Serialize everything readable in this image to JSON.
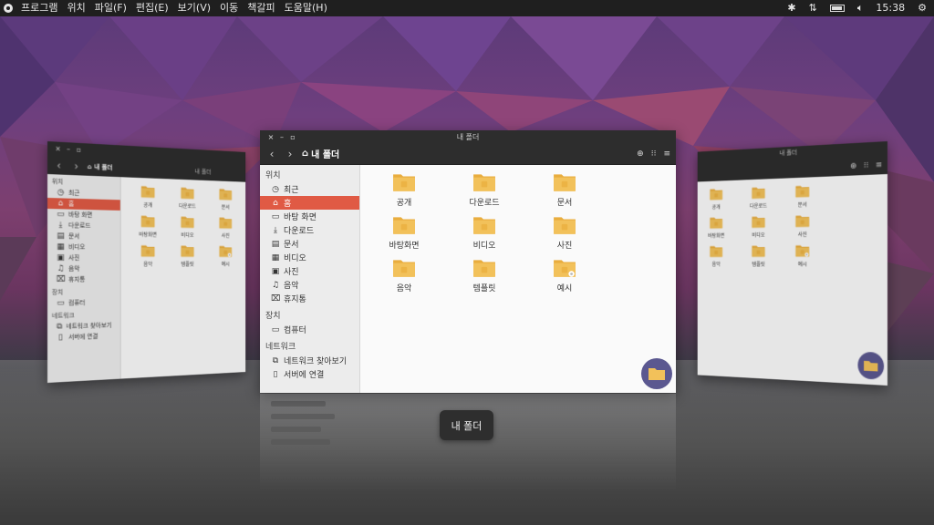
{
  "top_panel": {
    "menus": [
      "프로그램",
      "위치",
      "파일(F)",
      "편집(E)",
      "보기(V)",
      "이동",
      "책갈피",
      "도움말(H)"
    ],
    "clock": "15:38"
  },
  "main_window": {
    "title": "내 폴더",
    "path": "내 폴더",
    "sidebar": {
      "places_label": "위치",
      "places": [
        "최근",
        "홈",
        "바탕 화면",
        "다운로드",
        "문서",
        "비디오",
        "사진",
        "음악",
        "휴지통"
      ],
      "devices_label": "장치",
      "devices": [
        "컴퓨터"
      ],
      "network_label": "네트워크",
      "network": [
        "네트워크 찾아보기",
        "서버에 연결"
      ]
    },
    "folders": [
      "공개",
      "다운로드",
      "문서",
      "바탕화면",
      "비디오",
      "사진",
      "음악",
      "템플릿",
      "예시"
    ]
  },
  "left_window": {
    "title": "내 폴더",
    "path": "내 폴더",
    "sidebar": {
      "places_label": "위치",
      "places": [
        "최근",
        "홈",
        "바탕 화면",
        "다운로드",
        "문서",
        "비디오",
        "사진",
        "음악",
        "휴지통"
      ],
      "devices_label": "장치",
      "devices": [
        "컴퓨터"
      ],
      "network_label": "네트워크",
      "network": [
        "네트워크 찾아보기",
        "서버에 연결"
      ]
    },
    "folders": [
      "공개",
      "다운로드",
      "문서",
      "바탕화면",
      "비디오",
      "사진",
      "음악",
      "템플릿",
      "예시"
    ]
  },
  "right_window": {
    "title": "내 폴더",
    "folders": [
      "공개",
      "다운로드",
      "문서",
      "바탕화면",
      "비디오",
      "사진",
      "음악",
      "템플릿",
      "예시"
    ]
  },
  "tooltip": "내 폴더",
  "colors": {
    "accent": "#e05a44",
    "folder": "#f2c15a",
    "folder_tab": "#e9ad3e",
    "fab": "#5b5890",
    "panel": "#1f1f1f",
    "titlebar": "#2d2d2d"
  }
}
